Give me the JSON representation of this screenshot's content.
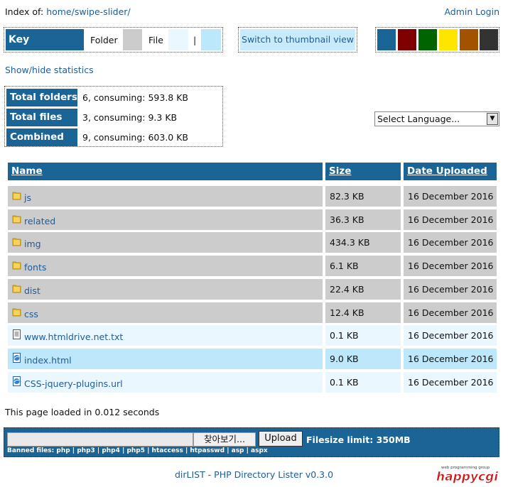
{
  "header": {
    "index_prefix": "Index of:",
    "path": "home/swipe-slider/",
    "admin_login": "Admin Login"
  },
  "key": {
    "title": "Key",
    "folder_label": "Folder",
    "file_label": "File",
    "separator": "|",
    "folder_color": "#cccccc",
    "file_color": "#eaf7ff",
    "hover_color": "#bde8fb"
  },
  "thumbnail_button": "Switch to thumbnail view",
  "themes": [
    "#1a6496",
    "#800000",
    "#006400",
    "#ffe600",
    "#a35200",
    "#333333"
  ],
  "stats_toggle": "Show/hide statistics",
  "stats": [
    {
      "label": "Total folders",
      "value": "6, consuming: 593.8 KB"
    },
    {
      "label": "Total files",
      "value": "3, consuming: 9.3 KB"
    },
    {
      "label": "Combined",
      "value": "9, consuming: 603.0 KB"
    }
  ],
  "language_select": {
    "selected": "Select Language...",
    "arrow": "▼"
  },
  "table": {
    "headers": {
      "name": "Name",
      "size": "Size",
      "date": "Date Uploaded"
    },
    "rows": [
      {
        "name": "js",
        "size": "82.3 KB",
        "date": "16 December 2016",
        "type": "folder"
      },
      {
        "name": "related",
        "size": "36.3 KB",
        "date": "16 December 2016",
        "type": "folder"
      },
      {
        "name": "img",
        "size": "434.3 KB",
        "date": "16 December 2016",
        "type": "folder"
      },
      {
        "name": "fonts",
        "size": "6.1 KB",
        "date": "16 December 2016",
        "type": "folder"
      },
      {
        "name": "dist",
        "size": "22.4 KB",
        "date": "16 December 2016",
        "type": "folder"
      },
      {
        "name": "css",
        "size": "12.4 KB",
        "date": "16 December 2016",
        "type": "folder"
      },
      {
        "name": "www.htmldrive.net.txt",
        "size": "0.1 KB",
        "date": "16 December 2016",
        "type": "text"
      },
      {
        "name": "index.html",
        "size": "9.0 KB",
        "date": "16 December 2016",
        "type": "web",
        "hover": true
      },
      {
        "name": "CSS-jquery-plugins.url",
        "size": "0.1 KB",
        "date": "16 December 2016",
        "type": "web"
      }
    ]
  },
  "load_time": "This page loaded in 0.012 seconds",
  "upload": {
    "browse_label": "찾아보기...",
    "upload_label": "Upload",
    "size_limit": "Filesize limit: 350MB",
    "banned": "Banned files: php | php3 | php4 | php5 | htaccess | htpasswd | asp | aspx"
  },
  "footer": "dirLIST - PHP Directory Lister v0.3.0",
  "brand": {
    "tagline": "web programming group",
    "name": "happycgi"
  }
}
